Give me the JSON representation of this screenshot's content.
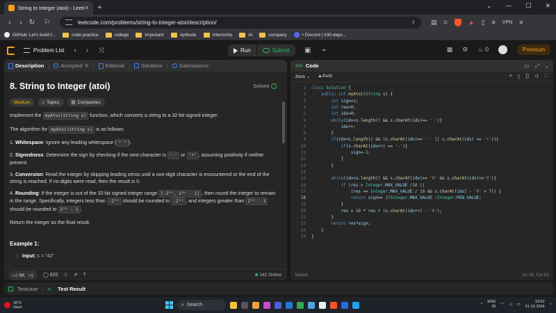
{
  "browser": {
    "tab_title": "String to Integer (atoi) - LeetCo",
    "url": "leetcode.com/problems/string-to-integer-atoi/description/",
    "vpn_label": "VPN",
    "bookmarks": [
      {
        "label": "GitHub: Let's build f...",
        "icon": "github-icon"
      },
      {
        "label": "code practice",
        "icon": "folder-icon"
      },
      {
        "label": "college",
        "icon": "folder-icon"
      },
      {
        "label": "Important",
        "icon": "folder-icon"
      },
      {
        "label": "Aptitude",
        "icon": "folder-icon"
      },
      {
        "label": "Internship",
        "icon": "folder-icon"
      },
      {
        "label": "AI",
        "icon": "folder-icon"
      },
      {
        "label": "company",
        "icon": "folder-icon"
      },
      {
        "label": "• Discord | #30-days...",
        "icon": "discord-icon"
      }
    ]
  },
  "header": {
    "problem_list": "Problem List",
    "run": "Run",
    "submit": "Submit",
    "streak": "0",
    "premium": "Premium"
  },
  "left": {
    "tabs": [
      "Description",
      "Accepted",
      "Editorial",
      "Solutions",
      "Submissions"
    ],
    "title": "8. String to Integer (atoi)",
    "solved": "Solved",
    "tags": [
      "Medium",
      "Topics",
      "Companies"
    ],
    "intro_a": "Implement the",
    "intro_code": "myAtoi(string s)",
    "intro_b": "function, which converts a string to a 32-bit signed integer.",
    "algo_a": "The algorithm for",
    "algo_code": "myAtoi(string s)",
    "algo_b": "is as follows:",
    "steps": [
      {
        "num": "1.",
        "head": "Whitespace",
        "text_a": ": Ignore any leading whitespace (",
        "code": "\" \"",
        "text_b": ")."
      },
      {
        "num": "2.",
        "head": "Signedness",
        "text_a": ": Determine the sign by checking if the next character is",
        "code": "'-'",
        "mid": "or",
        "code2": "'+'",
        "text_b": ", assuming positivity if neither present."
      },
      {
        "num": "3.",
        "head": "Conversion",
        "text_a": ": Read the integer by skipping leading zeros until a non-digit character is encountered or the end of the string is reached. If no digits were read, then the result is 0."
      },
      {
        "num": "4.",
        "head": "Rounding",
        "text_a": ": If the integer is out of the 32-bit signed integer range",
        "code": "[-2³¹, 2³¹ - 1]",
        "text_b": ", then round the integer to remain in the range. Specifically, integers less than",
        "code2": "-2³¹",
        "text_c": "should be rounded to",
        "code3": "-2³¹",
        "text_d": ", and integers greater than",
        "code4": "2³¹ - 1",
        "text_e": "should be rounded to",
        "code5": "2³¹ - 1",
        "text_f": "."
      }
    ],
    "return_text": "Return the integer as the final result.",
    "example_title": "Example 1:",
    "input_label": "Input:",
    "input_value": "s = \"42\"",
    "likes": "5K",
    "comments": "620",
    "online": "142 Online"
  },
  "right": {
    "code_tab": "Code",
    "language": "Java",
    "auto": "Auto",
    "saved": "Saved",
    "position": "Ln 18, Col 52",
    "current_line": 18,
    "lines": [
      "class Solution {",
      "    public int myAtoi(String s) {",
      "        int sign=1;",
      "        int res=0;",
      "        int idx=0;",
      "        while(idx<s.length() && s.charAt(idx)== ' '){",
      "            idx++;",
      "        }",
      "        if(idx<s.length() && (s.charAt(idx)== '-' || s.charAt(idx) == '+')){",
      "            if(s.charAt(idx++) == '-'){",
      "                sign=-1;",
      "            }",
      "        }",
      "",
      "        while(idx<s.length() && s.charAt(idx)>= '0' && s.charAt(idx)<='9'){",
      "            if (res > Integer.MAX_VALUE /10 ||",
      "                (res == Integer.MAX_VALUE / 10 && s.charAt(idx) - '0' > 7)) {",
      "                return sign== 1?Integer.MAX_VALUE :Integer.MIN_VALUE;",
      "            }",
      "            res = 10 * res + (s.charAt(idx++) - '0');",
      "        }",
      "        return res*sign;",
      "    }",
      "}"
    ]
  },
  "bottom": {
    "testcase": "Testcase",
    "test_result": "Test Result"
  },
  "taskbar": {
    "temp": "20°C",
    "weather": "Haze",
    "search": "Search",
    "lang": "ENG",
    "region": "IN",
    "time": "19:52",
    "date": "31-12-2024"
  }
}
